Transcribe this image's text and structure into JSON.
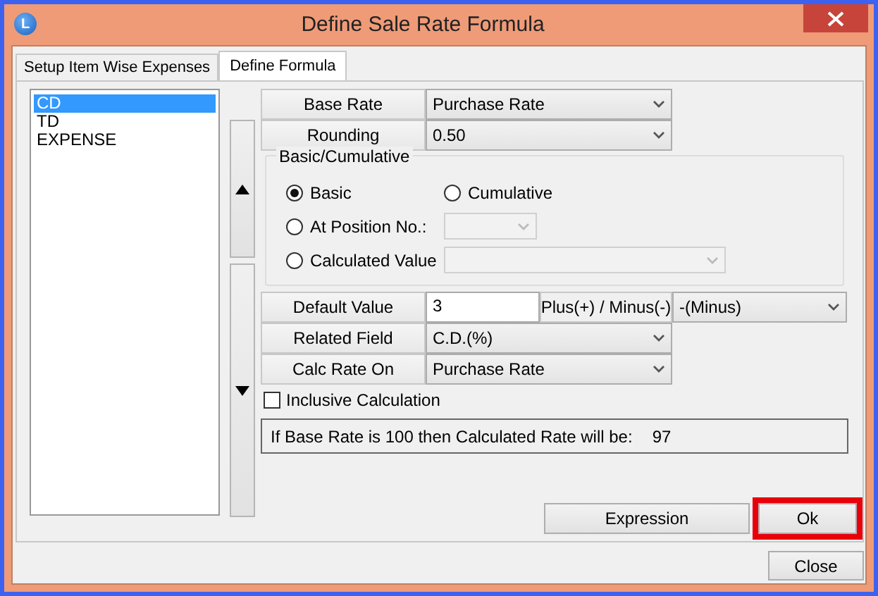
{
  "window": {
    "title": "Define Sale Rate Formula",
    "icon_letter": "L"
  },
  "tabs": [
    {
      "label": "Setup Item Wise Expenses",
      "selected": false
    },
    {
      "label": "Define Formula",
      "selected": true
    }
  ],
  "list": [
    {
      "label": "CD",
      "selected": true
    },
    {
      "label": "TD",
      "selected": false
    },
    {
      "label": "EXPENSE",
      "selected": false
    }
  ],
  "fields_top": [
    {
      "label": "Base Rate",
      "value": "Purchase Rate"
    },
    {
      "label": "Rounding",
      "value": "0.50"
    }
  ],
  "group": {
    "title": "Basic/Cumulative",
    "options": [
      {
        "label": "Basic",
        "selected": true,
        "kind": "plain"
      },
      {
        "label": "Cumulative",
        "selected": false,
        "kind": "plain"
      },
      {
        "label": "At Position No.:",
        "selected": false,
        "kind": "small-select"
      },
      {
        "label": "Calculated Value",
        "selected": false,
        "kind": "wide-select"
      }
    ]
  },
  "default_value": {
    "label": "Default Value",
    "value": "3",
    "sign_label": "Plus(+) / Minus(-)",
    "sign_value": "-(Minus)"
  },
  "fields_bottom": [
    {
      "label": "Related Field",
      "value": "C.D.(%)"
    },
    {
      "label": "Calc Rate On",
      "value": "Purchase Rate"
    }
  ],
  "inclusive": {
    "label": "Inclusive Calculation",
    "checked": false
  },
  "result": {
    "text": "If Base Rate is 100 then Calculated Rate will be:",
    "value": "97"
  },
  "buttons": [
    {
      "label": "Expression",
      "highlighted": false
    },
    {
      "label": "Ok",
      "highlighted": true
    }
  ],
  "close_button": "Close"
}
